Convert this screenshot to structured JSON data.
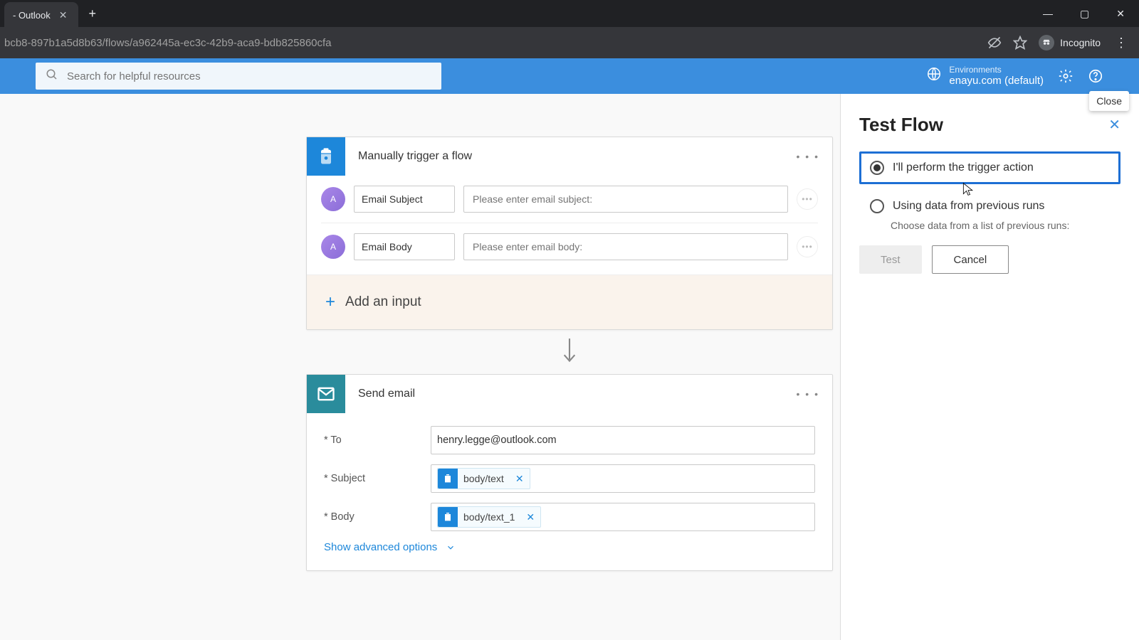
{
  "browser": {
    "tab_title": "- Outlook",
    "url": "bcb8-897b1a5d8b63/flows/a962445a-ec3c-42b9-aca9-bdb825860cfa",
    "incognito_label": "Incognito"
  },
  "header": {
    "search_placeholder": "Search for helpful resources",
    "env_label": "Environments",
    "env_value": "enayu.com (default)",
    "close_tooltip": "Close"
  },
  "trigger_card": {
    "title": "Manually trigger a flow",
    "params": [
      {
        "name": "Email Subject",
        "placeholder": "Please enter email subject:"
      },
      {
        "name": "Email Body",
        "placeholder": "Please enter email body:"
      }
    ],
    "add_input": "Add an input"
  },
  "action_card": {
    "title": "Send email",
    "fields": {
      "to_label": "* To",
      "to_value": "henry.legge@outlook.com",
      "subject_label": "* Subject",
      "subject_token": "body/text",
      "body_label": "* Body",
      "body_token": "body/text_1"
    },
    "show_advanced": "Show advanced options"
  },
  "test_panel": {
    "title": "Test Flow",
    "option1": "I'll perform the trigger action",
    "option2": "Using data from previous runs",
    "option2_sub": "Choose data from a list of previous runs:",
    "test_btn": "Test",
    "cancel_btn": "Cancel"
  }
}
